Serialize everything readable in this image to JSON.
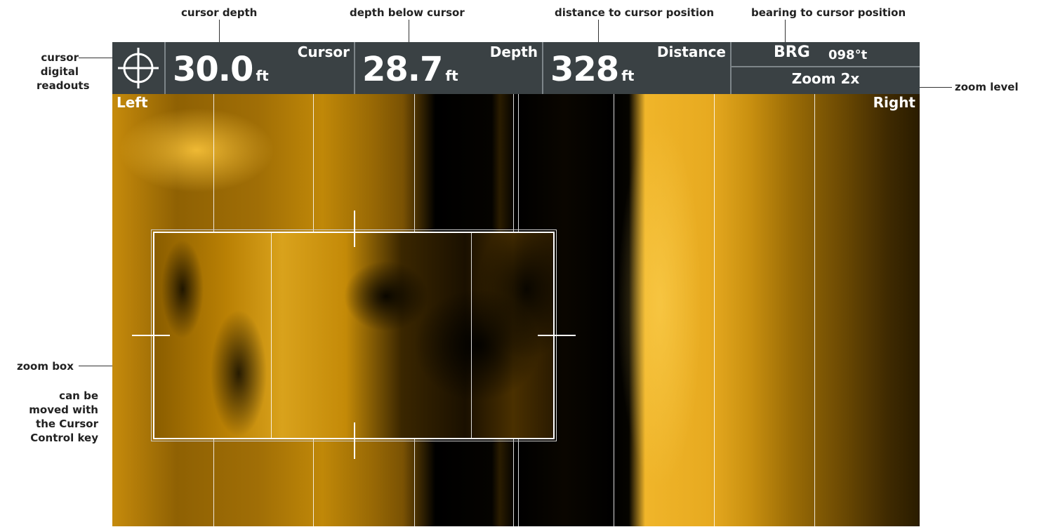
{
  "callouts": {
    "cursor_depth": "cursor depth",
    "depth_below_cursor": "depth below cursor",
    "distance_to_cursor": "distance to cursor position",
    "bearing_to_cursor": "bearing to cursor position",
    "cursor_readouts_l1": "cursor",
    "cursor_readouts_l2": "digital",
    "cursor_readouts_l3": "readouts",
    "zoom_level": "zoom level",
    "zoom_box": "zoom box",
    "zoom_box_note_l1": "can be",
    "zoom_box_note_l2": "moved with",
    "zoom_box_note_l3": "the Cursor",
    "zoom_box_note_l4": "Control key"
  },
  "databar": {
    "cursor": {
      "label": "Cursor",
      "value": "30.0",
      "unit": "ft"
    },
    "depth": {
      "label": "Depth",
      "value": "28.7",
      "unit": "ft"
    },
    "distance": {
      "label": "Distance",
      "value": "328",
      "unit": "ft"
    },
    "brg": {
      "label": "BRG",
      "value": "098°t"
    },
    "zoom": {
      "value": "Zoom 2x"
    }
  },
  "sonar": {
    "left_label": "Left",
    "right_label": "Right"
  },
  "colors": {
    "databar_bg": "#3a4144",
    "sonar_gold": "#d9a21c",
    "sonar_black": "#000000"
  }
}
